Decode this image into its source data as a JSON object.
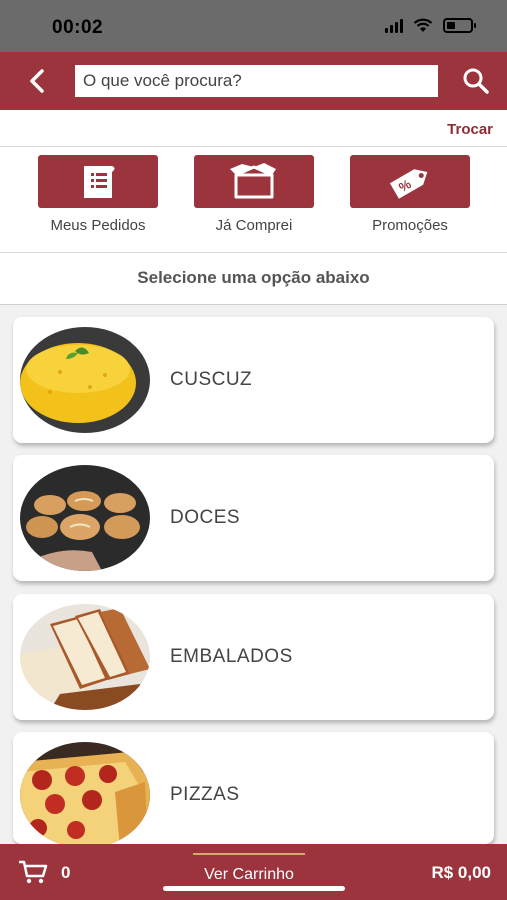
{
  "status_bar": {
    "time": "00:02"
  },
  "search": {
    "placeholder": "O que você procura?"
  },
  "header": {
    "trocar_label": "Trocar"
  },
  "shortcuts": [
    {
      "label": "Meus Pedidos",
      "icon": "receipt-icon"
    },
    {
      "label": "Já Comprei",
      "icon": "box-icon"
    },
    {
      "label": "Promoções",
      "icon": "price-tag-icon"
    }
  ],
  "section": {
    "title": "Selecione uma opção abaixo"
  },
  "categories": [
    {
      "name": "CUSCUZ"
    },
    {
      "name": "DOCES"
    },
    {
      "name": "EMBALADOS"
    },
    {
      "name": "PIZZAS"
    }
  ],
  "cart": {
    "count": "0",
    "button_label": "Ver Carrinho",
    "total": "R$ 0,00"
  },
  "colors": {
    "brand": "#9b343d",
    "accent_text": "#8f2d36",
    "status_bar": "#6b6b6b"
  }
}
